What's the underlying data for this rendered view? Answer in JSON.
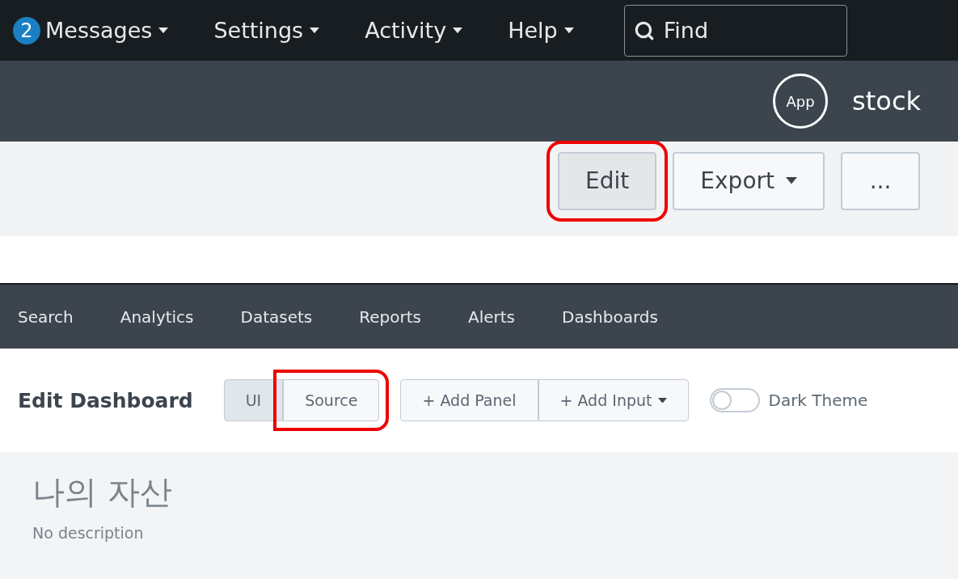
{
  "top_nav": {
    "badge": "2",
    "menus": [
      {
        "label": "Messages"
      },
      {
        "label": "Settings"
      },
      {
        "label": "Activity"
      },
      {
        "label": "Help"
      }
    ],
    "search": {
      "placeholder": "Find"
    }
  },
  "app_bar": {
    "icon_label": "App",
    "app_name": "stock"
  },
  "toolbar": {
    "buttons": [
      {
        "label": "Edit",
        "kind": "plain",
        "highlighted": true
      },
      {
        "label": "Export",
        "kind": "dropdown",
        "highlighted": false
      },
      {
        "label": "...",
        "kind": "plain",
        "highlighted": false
      }
    ]
  },
  "app_nav": {
    "items": [
      "Search",
      "Analytics",
      "Datasets",
      "Reports",
      "Alerts",
      "Dashboards"
    ]
  },
  "edit_bar": {
    "title": "Edit Dashboard",
    "mode_tabs": [
      {
        "label": "UI",
        "selected": true,
        "highlighted": false
      },
      {
        "label": "Source",
        "selected": false,
        "highlighted": true
      }
    ],
    "add_buttons": [
      {
        "label": "+ Add Panel",
        "kind": "plain"
      },
      {
        "label": "+ Add Input",
        "kind": "dropdown"
      }
    ],
    "dark_theme": {
      "label": "Dark Theme",
      "on": false
    }
  },
  "dashboard": {
    "title": "나의 자산",
    "description": "No description"
  }
}
